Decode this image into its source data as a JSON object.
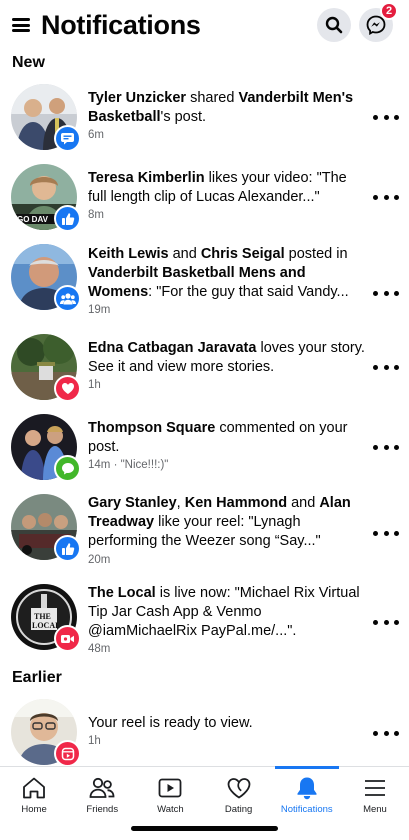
{
  "header": {
    "title": "Notifications",
    "messenger_badge": "2"
  },
  "sections": {
    "new": "New",
    "earlier": "Earlier"
  },
  "notifications": [
    {
      "parts": [
        [
          "Tyler Unzicker",
          true
        ],
        [
          " shared ",
          false
        ],
        [
          "Vanderbilt Men's Basketball",
          true
        ],
        [
          "'s post.",
          false
        ]
      ],
      "time": "6m",
      "badge": "share",
      "badge_color": "#1877f2"
    },
    {
      "parts": [
        [
          "Teresa Kimberlin",
          true
        ],
        [
          " likes your video: \"The full length clip of Lucas Alexander...\"",
          false
        ]
      ],
      "time": "8m",
      "badge": "like",
      "badge_color": "#1877f2"
    },
    {
      "parts": [
        [
          "Keith Lewis",
          true
        ],
        [
          " and ",
          false
        ],
        [
          "Chris Seigal",
          true
        ],
        [
          " posted in ",
          false
        ],
        [
          "Vanderbilt Basketball Mens and Womens",
          true
        ],
        [
          ": \"For the guy that said Vandy...",
          false
        ]
      ],
      "time": "19m",
      "badge": "group",
      "badge_color": "#1877f2"
    },
    {
      "parts": [
        [
          "Edna Catbagan Jaravata",
          true
        ],
        [
          " loves your story. See it and view more stories.",
          false
        ]
      ],
      "time": "1h",
      "badge": "love",
      "badge_color": "#f02849"
    },
    {
      "parts": [
        [
          "Thompson Square",
          true
        ],
        [
          " commented on your post.",
          false
        ]
      ],
      "time": "14m · \"Nice!!!:)\"",
      "badge": "comment",
      "badge_color": "#42b72a"
    },
    {
      "parts": [
        [
          "Gary Stanley",
          true
        ],
        [
          ", ",
          false
        ],
        [
          "Ken Hammond",
          true
        ],
        [
          " and ",
          false
        ],
        [
          "Alan Treadway",
          true
        ],
        [
          " like your reel: \"Lynagh performing the Weezer song “Say...\"",
          false
        ]
      ],
      "time": "20m",
      "badge": "like",
      "badge_color": "#1877f2"
    },
    {
      "parts": [
        [
          "The Local",
          true
        ],
        [
          " is live now: \"Michael Rix Virtual Tip Jar Cash App & Venmo @iamMichaelRix PayPal.me/...\".",
          false
        ]
      ],
      "time": "48m",
      "badge": "live",
      "badge_color": "#f02849"
    },
    {
      "parts": [
        [
          "Your reel is ready to view.",
          false
        ]
      ],
      "time": "1h",
      "badge": "reel",
      "badge_color": "#f02849"
    }
  ],
  "tabs": [
    {
      "label": "Home",
      "icon": "home-icon"
    },
    {
      "label": "Friends",
      "icon": "friends-icon"
    },
    {
      "label": "Watch",
      "icon": "watch-icon"
    },
    {
      "label": "Dating",
      "icon": "dating-icon"
    },
    {
      "label": "Notifications",
      "icon": "bell-icon",
      "active": true
    },
    {
      "label": "Menu",
      "icon": "menu-icon"
    }
  ],
  "colors": {
    "accent": "#1877f2",
    "badge_red": "#e41e3f",
    "secondary_text": "#65676b"
  }
}
